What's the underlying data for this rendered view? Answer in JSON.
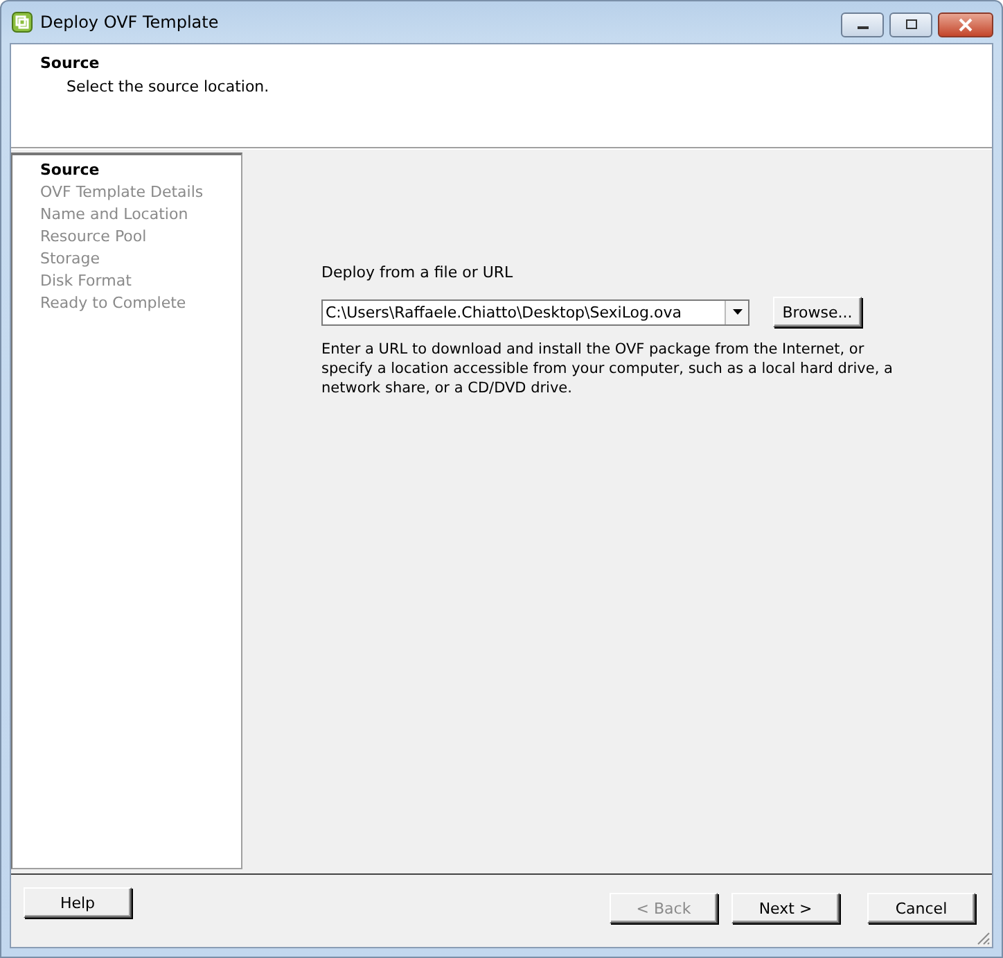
{
  "window": {
    "title": "Deploy OVF Template"
  },
  "header": {
    "title": "Source",
    "subtitle": "Select the source location."
  },
  "steps": [
    {
      "label": "Source",
      "selected": true
    },
    {
      "label": "OVF Template Details",
      "selected": false
    },
    {
      "label": "Name and Location",
      "selected": false
    },
    {
      "label": "Resource Pool",
      "selected": false
    },
    {
      "label": "Storage",
      "selected": false
    },
    {
      "label": "Disk Format",
      "selected": false
    },
    {
      "label": "Ready to Complete",
      "selected": false
    }
  ],
  "source": {
    "label": "Deploy from a file or URL",
    "value": "C:\\Users\\Raffaele.Chiatto\\Desktop\\SexiLog.ova",
    "browse": "Browse...",
    "help_text": "Enter a URL to download and install the OVF package from the Internet, or specify a location accessible from your computer, such as a local hard drive, a network share, or a CD/DVD drive."
  },
  "buttons": [
    {
      "label": "Help",
      "disabled": false
    },
    {
      "label": "< Back",
      "disabled": true
    },
    {
      "label": "Next >",
      "disabled": false
    },
    {
      "label": "Cancel",
      "disabled": false
    }
  ]
}
